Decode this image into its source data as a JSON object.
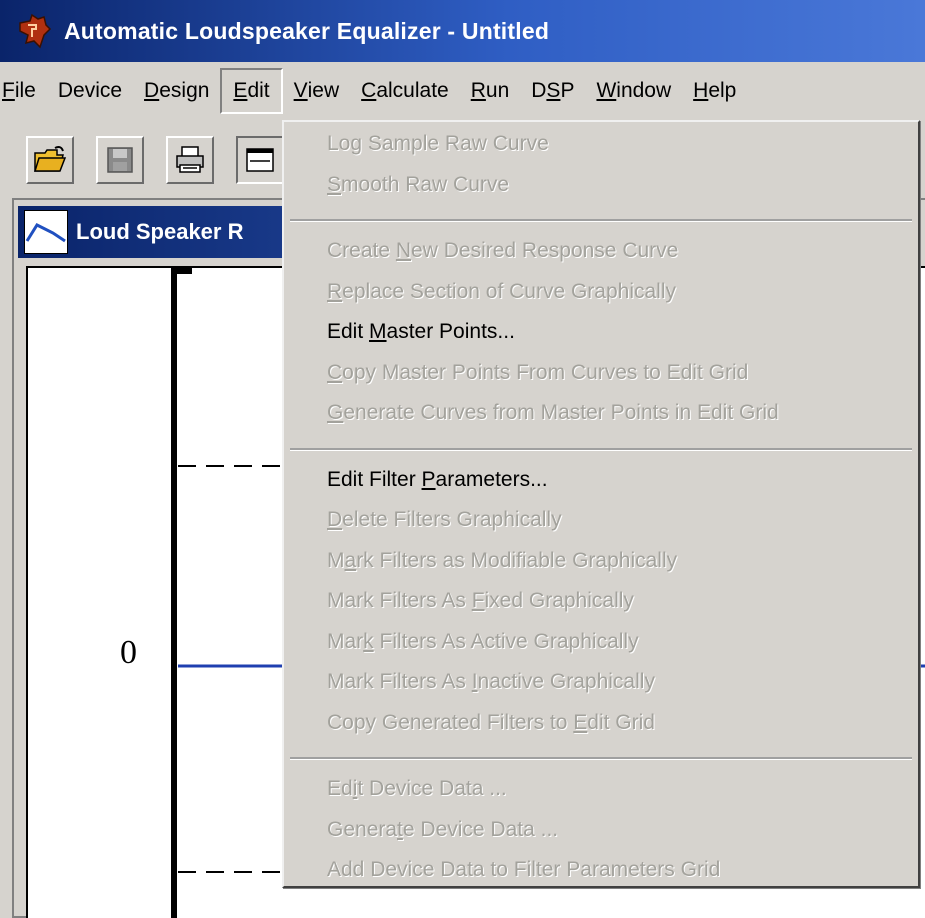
{
  "window": {
    "title": "Automatic Loudspeaker Equalizer - Untitled",
    "child_title": "Loud Speaker R"
  },
  "menubar": [
    {
      "label": "File",
      "ul": "F",
      "rest": "ile"
    },
    {
      "label": "Device",
      "ul": "",
      "rest": "Device"
    },
    {
      "label": "Design",
      "ul": "D",
      "rest": "esign"
    },
    {
      "label": "Edit",
      "ul": "E",
      "rest": "dit"
    },
    {
      "label": "View",
      "ul": "V",
      "rest": "iew"
    },
    {
      "label": "Calculate",
      "ul": "C",
      "rest": "alculate"
    },
    {
      "label": "Run",
      "ul": "R",
      "rest": "un"
    },
    {
      "label": "DSP",
      "pre": "D",
      "ul": "S",
      "rest": "P"
    },
    {
      "label": "Window",
      "ul": "W",
      "rest": "indow"
    },
    {
      "label": "Help",
      "ul": "H",
      "rest": "elp"
    }
  ],
  "toolbar": [
    {
      "icon": "open-folder-icon"
    },
    {
      "icon": "save-disk-icon"
    },
    {
      "icon": "printer-icon"
    },
    {
      "icon": "chart-window-icon"
    }
  ],
  "plot": {
    "y_tick_label": "0"
  },
  "edit_menu": {
    "groups": [
      [
        {
          "pre": "Log Sample Raw Curve",
          "ul": "",
          "post": "",
          "enabled": false
        },
        {
          "pre": "",
          "ul": "S",
          "post": "mooth Raw Curve",
          "enabled": false
        }
      ],
      [
        {
          "pre": "Create ",
          "ul": "N",
          "post": "ew Desired Response Curve",
          "enabled": false
        },
        {
          "pre": "",
          "ul": "R",
          "post": "eplace Section of Curve Graphically",
          "enabled": false
        },
        {
          "pre": "Edit ",
          "ul": "M",
          "post": "aster Points...",
          "enabled": true
        },
        {
          "pre": "",
          "ul": "C",
          "post": "opy Master Points From Curves to Edit Grid",
          "enabled": false
        },
        {
          "pre": "",
          "ul": "G",
          "post": "enerate Curves from Master Points in Edit Grid",
          "enabled": false
        }
      ],
      [
        {
          "pre": "Edit Filter ",
          "ul": "P",
          "post": "arameters...",
          "enabled": true
        },
        {
          "pre": "",
          "ul": "D",
          "post": "elete Filters Graphically",
          "enabled": false
        },
        {
          "pre": "M",
          "ul": "a",
          "post": "rk Filters as Modifiable Graphically",
          "enabled": false
        },
        {
          "pre": "Mark Filters As ",
          "ul": "F",
          "post": "ixed Graphically",
          "enabled": false
        },
        {
          "pre": "Mar",
          "ul": "k",
          "post": " Filters As Active Graphically",
          "enabled": false
        },
        {
          "pre": "Mark Filters As ",
          "ul": "I",
          "post": "nactive Graphically",
          "enabled": false
        },
        {
          "pre": "Copy Generated Filters to ",
          "ul": "E",
          "post": "dit Grid",
          "enabled": false
        }
      ],
      [
        {
          "pre": "Ed",
          "ul": "i",
          "post": "t Device Data ...",
          "enabled": false
        },
        {
          "pre": "Genera",
          "ul": "t",
          "post": "e Device Data ...",
          "enabled": false
        },
        {
          "pre": "Add Device Data to Filter Parameters Grid",
          "ul": "",
          "post": "",
          "enabled": false
        }
      ]
    ]
  },
  "colors": {
    "titlebar_start": "#0a246a",
    "titlebar_end": "#4a78d8",
    "face": "#d6d3ce",
    "disabled_text": "#a3a29c",
    "plot_line": "#1f3fb0"
  }
}
